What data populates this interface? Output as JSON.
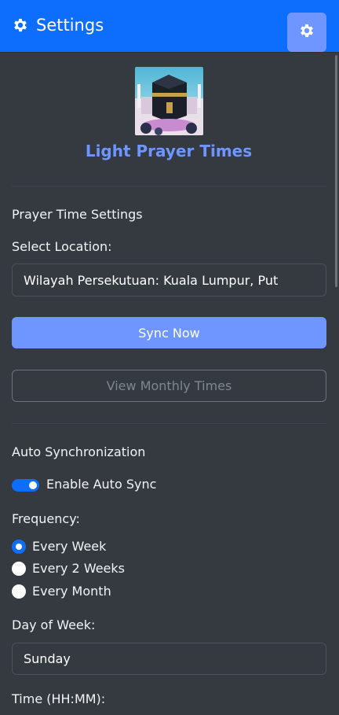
{
  "header": {
    "title": "Settings",
    "icon": "gear-icon",
    "settings_button_icon": "gear-icon"
  },
  "app": {
    "name": "Light Prayer Times",
    "logo": "kaaba-logo"
  },
  "prayer_settings": {
    "section_title": "Prayer Time Settings",
    "location_label": "Select Location:",
    "location_value": "Wilayah Persekutuan: Kuala Lumpur, Put",
    "sync_button": "Sync Now",
    "monthly_button": "View Monthly Times"
  },
  "auto_sync": {
    "section_title": "Auto Synchronization",
    "enable_label": "Enable Auto Sync",
    "enabled": true,
    "frequency_label": "Frequency:",
    "frequency_options": [
      "Every Week",
      "Every 2 Weeks",
      "Every Month"
    ],
    "frequency_selected": "Every Week",
    "day_label": "Day of Week:",
    "day_value": "Sunday",
    "time_label": "Time (HH:MM):"
  },
  "colors": {
    "primary": "#0d6efd",
    "accent": "#6f96ff",
    "background": "#343a40"
  }
}
